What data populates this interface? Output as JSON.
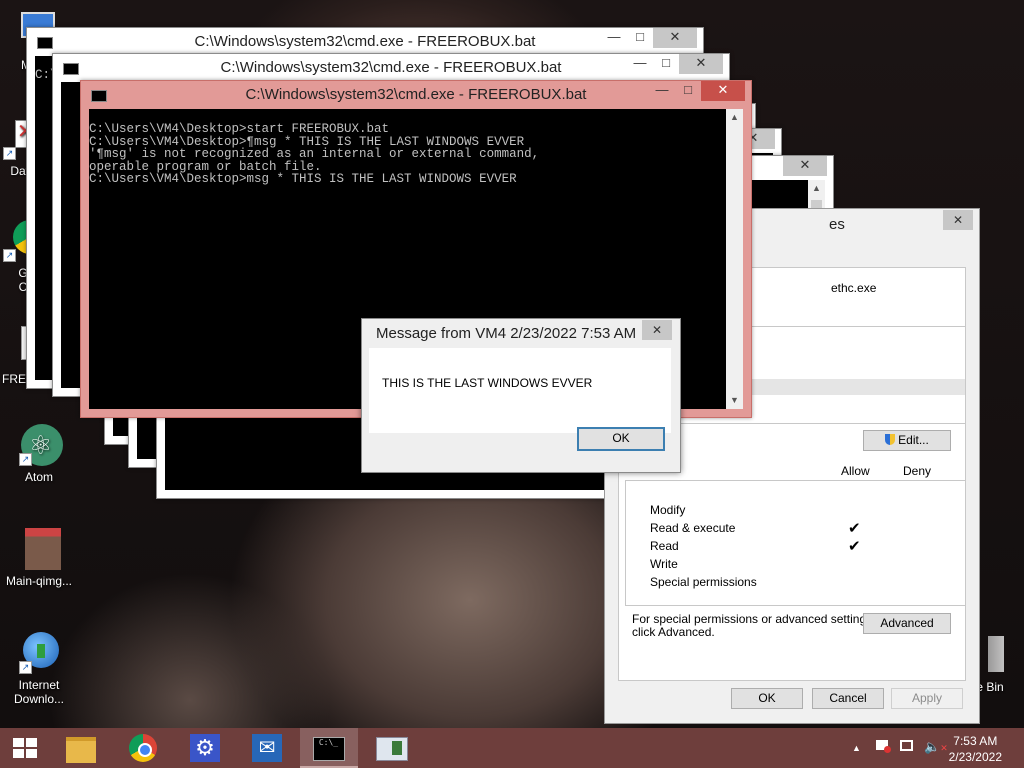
{
  "desktop": {
    "icons": [
      {
        "label": "My C"
      },
      {
        "label": "Data"
      },
      {
        "label": "G"
      },
      {
        "label": "C"
      },
      {
        "label": "FREEROB"
      },
      {
        "label": "Atom"
      },
      {
        "label": "Main-qimg..."
      },
      {
        "label": "Internet"
      },
      {
        "label": "Downlo..."
      },
      {
        "label": "e Bin"
      }
    ]
  },
  "cmd_windows": {
    "title": "C:\\Windows\\system32\\cmd.exe - FREEROBUX.bat",
    "console_lines": [
      "C:\\Users\\VM4\\Desktop>start FREEROBUX.bat",
      "",
      "C:\\Users\\VM4\\Desktop>¶msg * THIS IS THE LAST WINDOWS EVVER",
      "'¶msg' is not recognized as an internal or external command,",
      "operable program or batch file.",
      "",
      "C:\\Users\\VM4\\Desktop>msg * THIS IS THE LAST WINDOWS EVVER"
    ],
    "ghost_text": "WINDOWS EVVER",
    "close_glyph": "✕",
    "min_glyph": "—",
    "max_glyph": "□"
  },
  "message_box": {
    "title": "Message from VM4 2/23/2022 7:53 AM",
    "text": "THIS IS THE LAST WINDOWS EVVER",
    "ok": "OK",
    "close_glyph": "✕"
  },
  "properties": {
    "title_fragment": "es",
    "object_name": "ethc.exe",
    "edit_button": "Edit...",
    "col_allow": "Allow",
    "col_deny": "Deny",
    "permissions": [
      {
        "name": "Modify",
        "allow": ""
      },
      {
        "name": "Read & execute",
        "allow": "✔"
      },
      {
        "name": "Read",
        "allow": "✔"
      },
      {
        "name": "Write",
        "allow": ""
      },
      {
        "name": "Special permissions",
        "allow": ""
      }
    ],
    "advanced_note_1": "For special permissions or advanced settings,",
    "advanced_note_2": "click Advanced.",
    "advanced_button": "Advanced",
    "ok": "OK",
    "cancel": "Cancel",
    "apply": "Apply",
    "close_glyph": "✕"
  },
  "taskbar": {
    "time": "7:53 AM",
    "date": "2/23/2022",
    "tray_arrow": "▲"
  }
}
